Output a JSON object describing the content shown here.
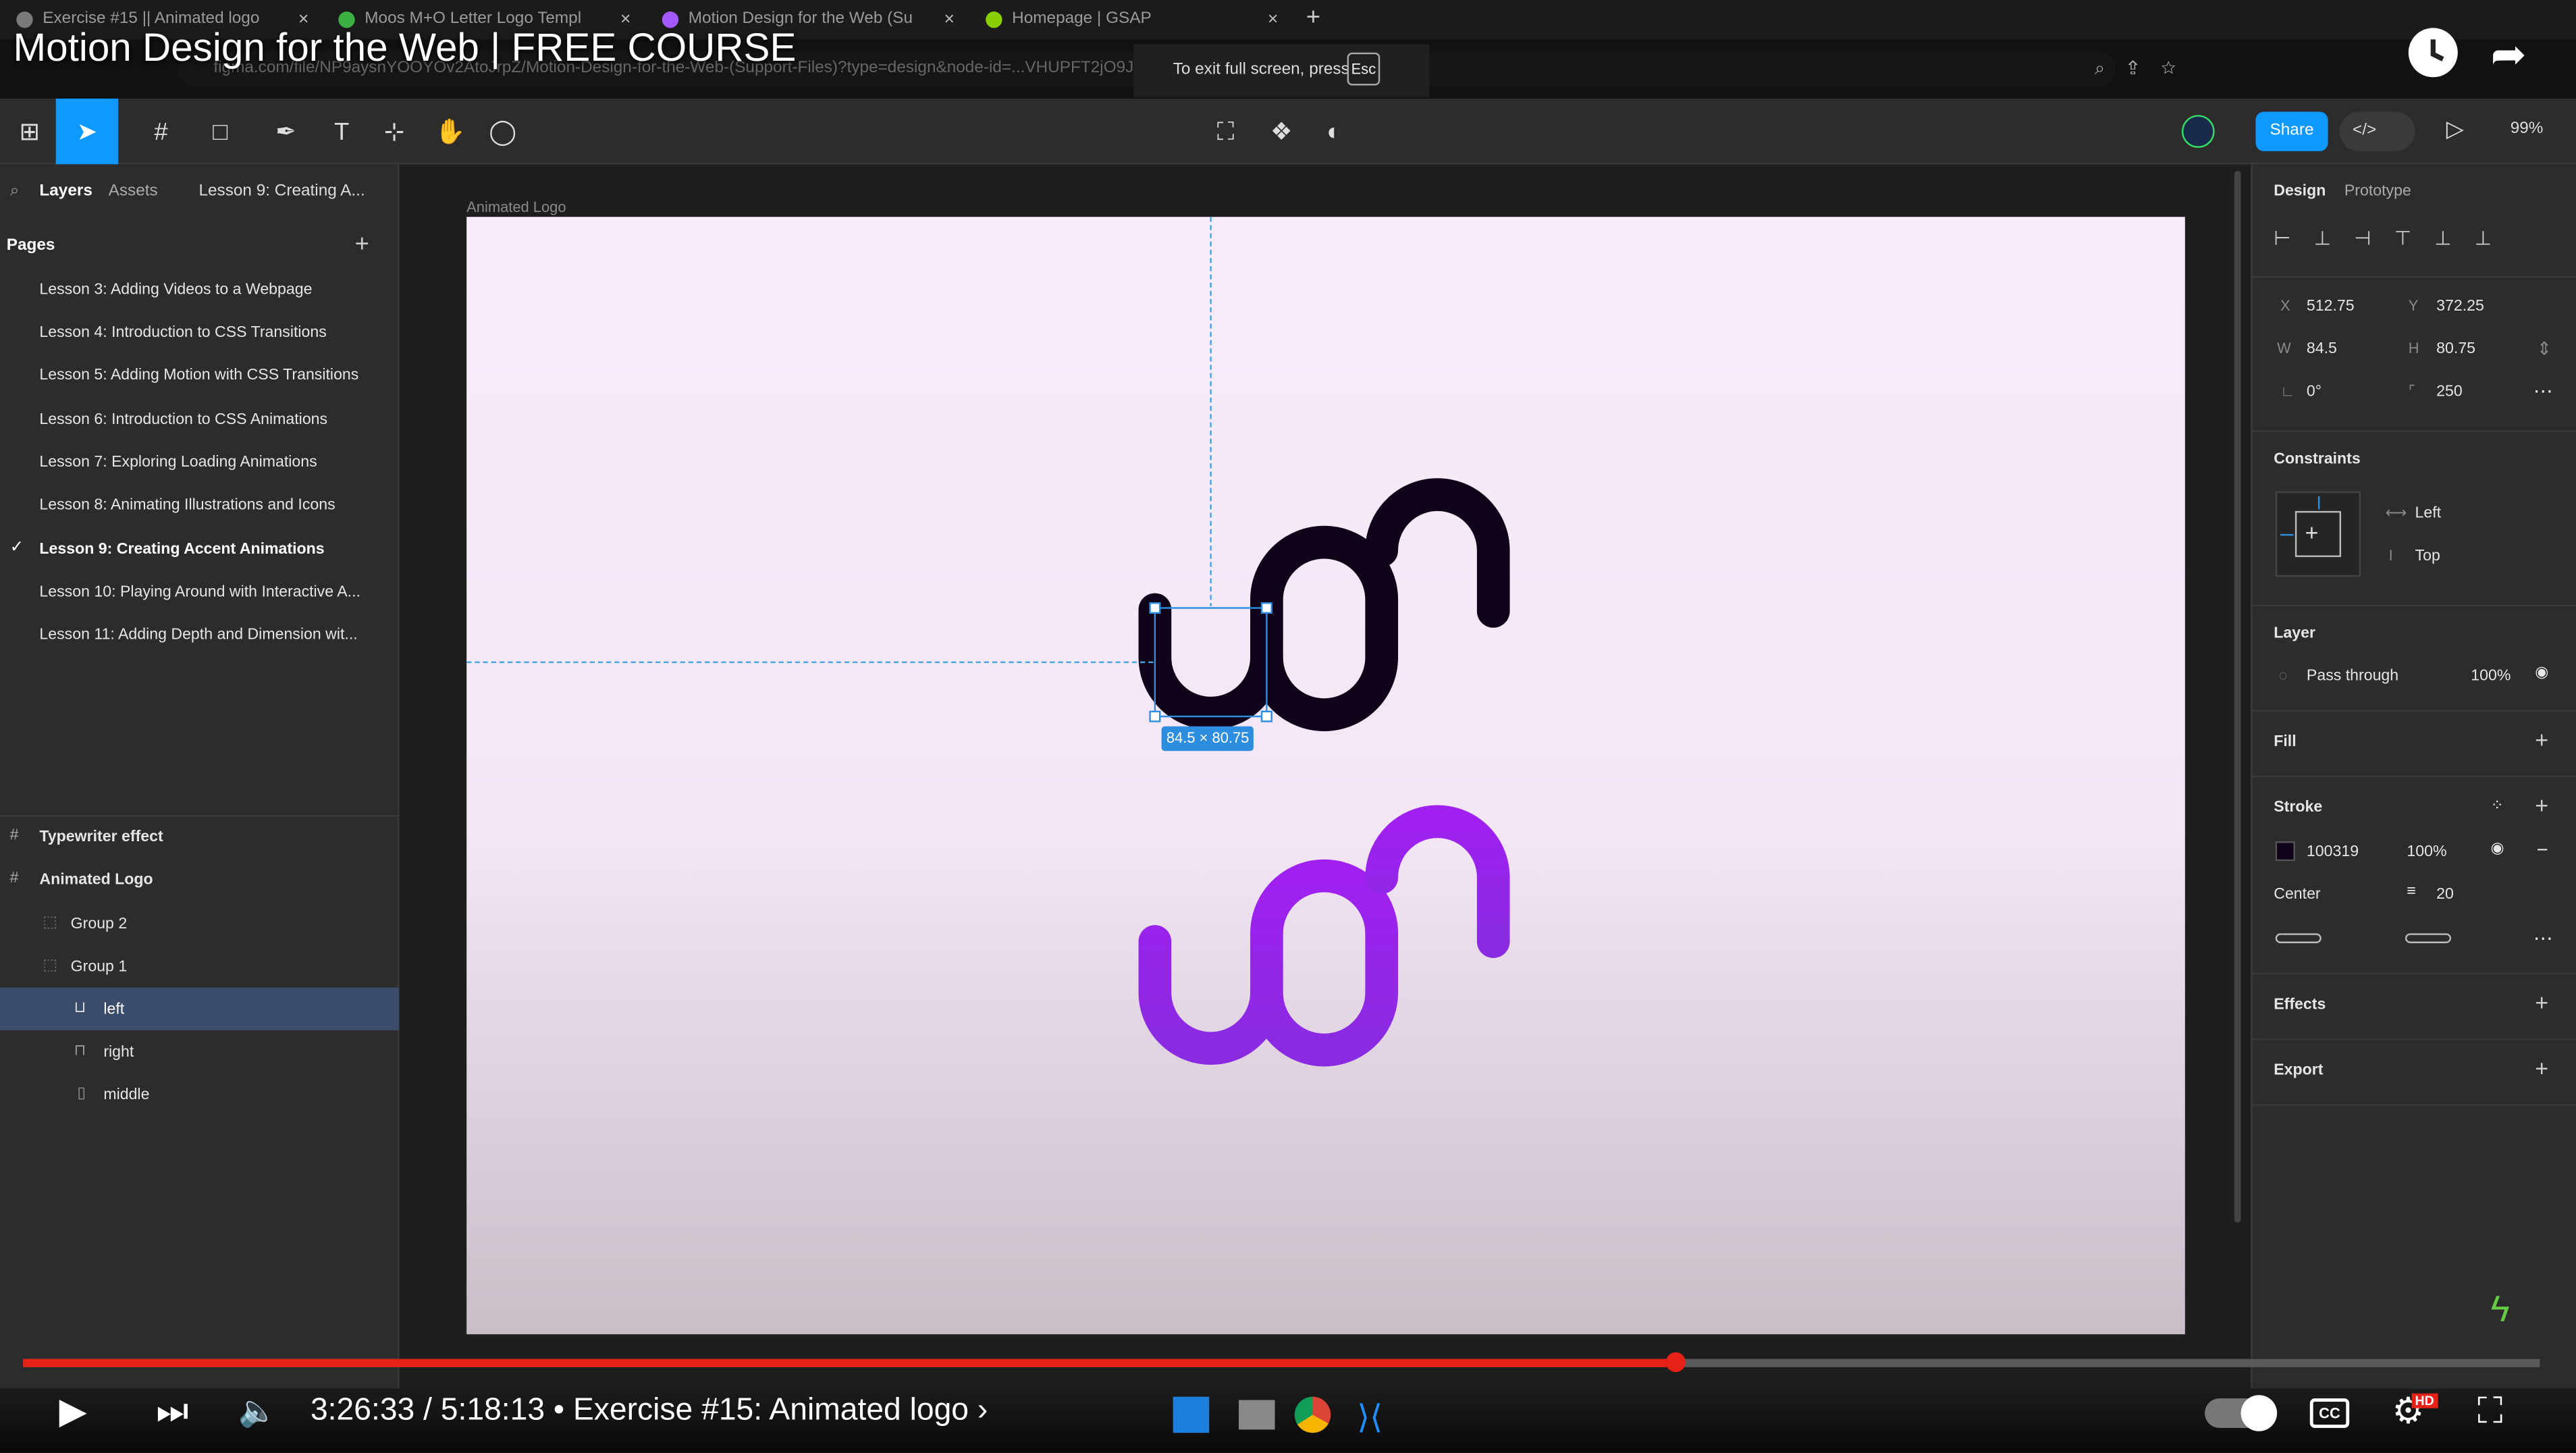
{
  "video": {
    "title": "Motion Design for the Web | FREE COURSE",
    "time_current": "3:26:33",
    "time_total": "5:18:13",
    "chapter": "• Exercise #15: Animated logo ›",
    "time_display": "3:26:33 / 5:18:13",
    "progress_fraction": 0.657,
    "hd_badge": "HD"
  },
  "browser": {
    "tabs": [
      {
        "label": "Exercise #15 || Animated logo",
        "fav": "#7a7a7a"
      },
      {
        "label": "Moos M+O Letter Logo Templ",
        "fav": "#3cb043"
      },
      {
        "label": "Motion Design for the Web (Su",
        "fav": "#a259ff"
      },
      {
        "label": "Homepage | GSAP",
        "fav": "#88ce02"
      }
    ],
    "url": "figma.com/file/NP9aysnYOOYOv2AtoJrpZ/Motion-Design-for-the-Web-(Support-Files)?type=design&node-id=...VHUPFT2jO9J-0",
    "fullscreen_notice": "To exit full screen, press",
    "esc_key": "Esc"
  },
  "figma": {
    "zoom": "99%",
    "share_label": "Share",
    "left_tabs": {
      "layers": "Layers",
      "assets": "Assets",
      "current_page": "Lesson 9: Creating A..."
    },
    "pages_heading": "Pages",
    "pages": [
      "Lesson 3: Adding Videos to a Webpage",
      "Lesson 4: Introduction to CSS Transitions",
      "Lesson 5: Adding Motion with CSS Transitions",
      "Lesson 6: Introduction to CSS Animations",
      "Lesson 7: Exploring Loading Animations",
      "Lesson 8: Animating Illustrations and Icons",
      "Lesson 9: Creating Accent Animations",
      "Lesson 10: Playing Around with Interactive A...",
      "Lesson 11: Adding Depth and Dimension wit..."
    ],
    "active_page_checkmark": "✓",
    "layers": [
      {
        "label": "Typewriter effect",
        "indent": 0,
        "bold": true
      },
      {
        "label": "Animated Logo",
        "indent": 0,
        "bold": true
      },
      {
        "label": "Group 2",
        "indent": 1,
        "bold": false
      },
      {
        "label": "Group 1",
        "indent": 1,
        "bold": false
      },
      {
        "label": "left",
        "indent": 2,
        "bold": false
      },
      {
        "label": "right",
        "indent": 2,
        "bold": false
      },
      {
        "label": "middle",
        "indent": 2,
        "bold": false
      }
    ],
    "frame_name": "Animated Logo",
    "selection_size": "84.5 × 80.75",
    "stroke_color_dark": "#100319",
    "gradient_top": "#a020f0",
    "gradient_bottom": "#8a2be2",
    "design": {
      "tab_design": "Design",
      "tab_prototype": "Prototype",
      "x_label": "X",
      "x": "512.75",
      "y_label": "Y",
      "y": "372.25",
      "w_label": "W",
      "w": "84.5",
      "h_label": "H",
      "h": "80.75",
      "rotation": "0°",
      "radius": "250",
      "constraints": "Constraints",
      "constraint_h": "Left",
      "constraint_v": "Top",
      "layer": "Layer",
      "blend": "Pass through",
      "opacity": "100%",
      "fill": "Fill",
      "stroke": "Stroke",
      "stroke_hex": "100319",
      "stroke_opacity": "100%",
      "stroke_align": "Center",
      "stroke_weight": "20",
      "effects": "Effects",
      "export": "Export"
    }
  }
}
